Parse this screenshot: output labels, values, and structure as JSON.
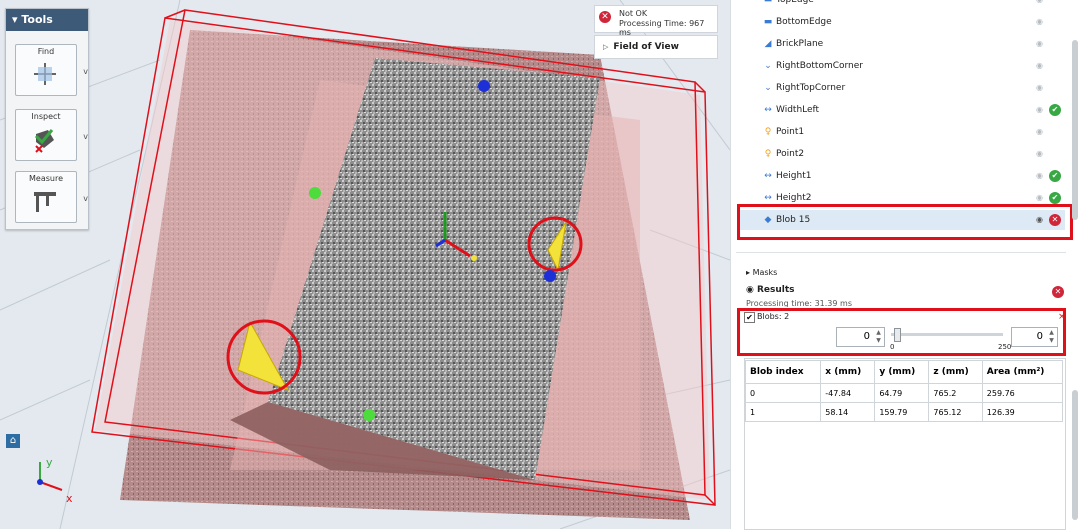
{
  "tools_panel": {
    "title": "Tools",
    "items": [
      {
        "label": "Find",
        "icon": "find-axes-icon"
      },
      {
        "label": "Inspect",
        "icon": "inspect-icon"
      },
      {
        "label": "Measure",
        "icon": "caliper-icon"
      }
    ]
  },
  "status": {
    "state": "Not OK",
    "processing": "Processing Time: 967 ms",
    "icon": "error-icon"
  },
  "field_of_view": "Field of View",
  "tree": {
    "items": [
      {
        "label": "TopEdge",
        "icon": "edge-icon",
        "status": ""
      },
      {
        "label": "BottomEdge",
        "icon": "edge-icon",
        "status": ""
      },
      {
        "label": "BrickPlane",
        "icon": "plane-icon",
        "status": ""
      },
      {
        "label": "RightBottomCorner",
        "icon": "corner-icon",
        "status": ""
      },
      {
        "label": "RightTopCorner",
        "icon": "corner-icon",
        "status": ""
      },
      {
        "label": "WidthLeft",
        "icon": "distance-icon",
        "status": "ok"
      },
      {
        "label": "Point1",
        "icon": "point-icon",
        "status": ""
      },
      {
        "label": "Point2",
        "icon": "point-icon",
        "status": ""
      },
      {
        "label": "Height1",
        "icon": "distance-icon",
        "status": "ok"
      },
      {
        "label": "Height2",
        "icon": "distance-icon",
        "status": "ok"
      },
      {
        "label": "Blob 15",
        "icon": "blob-icon",
        "status": "fail"
      }
    ]
  },
  "masks_label": "Masks",
  "results": {
    "label": "Results",
    "processing_time": "Processing time: 31.39 ms",
    "blobs_label": "Blobs: 2",
    "min_value": "0",
    "max_value": "0",
    "slider_min": "0",
    "slider_max": "250",
    "slider_level": 0.03
  },
  "table": {
    "headers": [
      "Blob index",
      "x (mm)",
      "y (mm)",
      "z (mm)",
      "Area (mm²)"
    ],
    "rows": [
      [
        "0",
        "-47.84",
        "64.79",
        "765.2",
        "259.76"
      ],
      [
        "1",
        "58.14",
        "159.79",
        "765.12",
        "126.39"
      ]
    ]
  },
  "axes": {
    "y": "y",
    "x": "x"
  },
  "colors": {
    "highlight_red": "#e0101a",
    "ok_green": "#37a843",
    "fail_red": "#d0263a",
    "header_blue": "#3d5a78"
  }
}
